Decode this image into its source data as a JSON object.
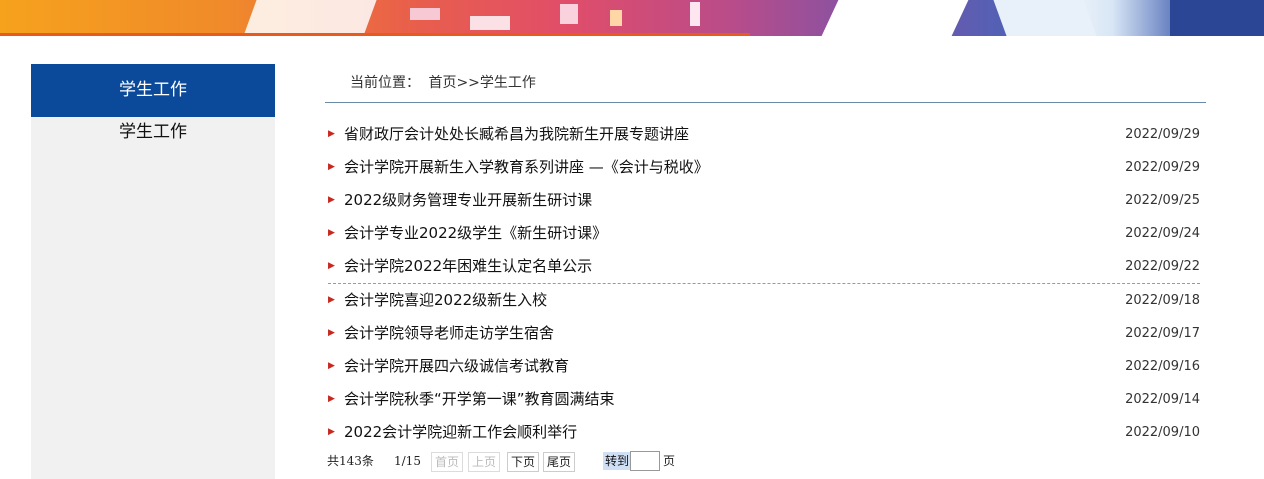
{
  "sidebar": {
    "header": "学生工作",
    "items": [
      {
        "label": "学生工作"
      }
    ]
  },
  "breadcrumb": {
    "prefix": "当前位置：",
    "home": "首页",
    "sep": ">>",
    "current": "学生工作"
  },
  "news": [
    {
      "title": "省财政厅会计处处长臧希昌为我院新生开展专题讲座",
      "date": "2022/09/29"
    },
    {
      "title": "会计学院开展新生入学教育系列讲座 —《会计与税收》",
      "date": "2022/09/29"
    },
    {
      "title": "2022级财务管理专业开展新生研讨课",
      "date": "2022/09/25"
    },
    {
      "title": "会计学专业2022级学生《新生研讨课》",
      "date": "2022/09/24"
    },
    {
      "title": "会计学院2022年困难生认定名单公示",
      "date": "2022/09/22"
    },
    {
      "title": "会计学院喜迎2022级新生入校",
      "date": "2022/09/18"
    },
    {
      "title": "会计学院领导老师走访学生宿舍",
      "date": "2022/09/17"
    },
    {
      "title": "会计学院开展四六级诚信考试教育",
      "date": "2022/09/16"
    },
    {
      "title": "会计学院秋季“开学第一课”教育圆满结束",
      "date": "2022/09/14"
    },
    {
      "title": "2022会计学院迎新工作会顺利举行",
      "date": "2022/09/10"
    }
  ],
  "pager": {
    "total": "共143条",
    "page": "1/15",
    "first": "首页",
    "prev": "上页",
    "next": "下页",
    "last": "尾页",
    "goto": "转到",
    "unit": "页",
    "input_value": ""
  },
  "colors": {
    "sidebar_header": "#0b4a9b",
    "arrow": "#c8281e",
    "banner_accent": "#e95a1e"
  }
}
